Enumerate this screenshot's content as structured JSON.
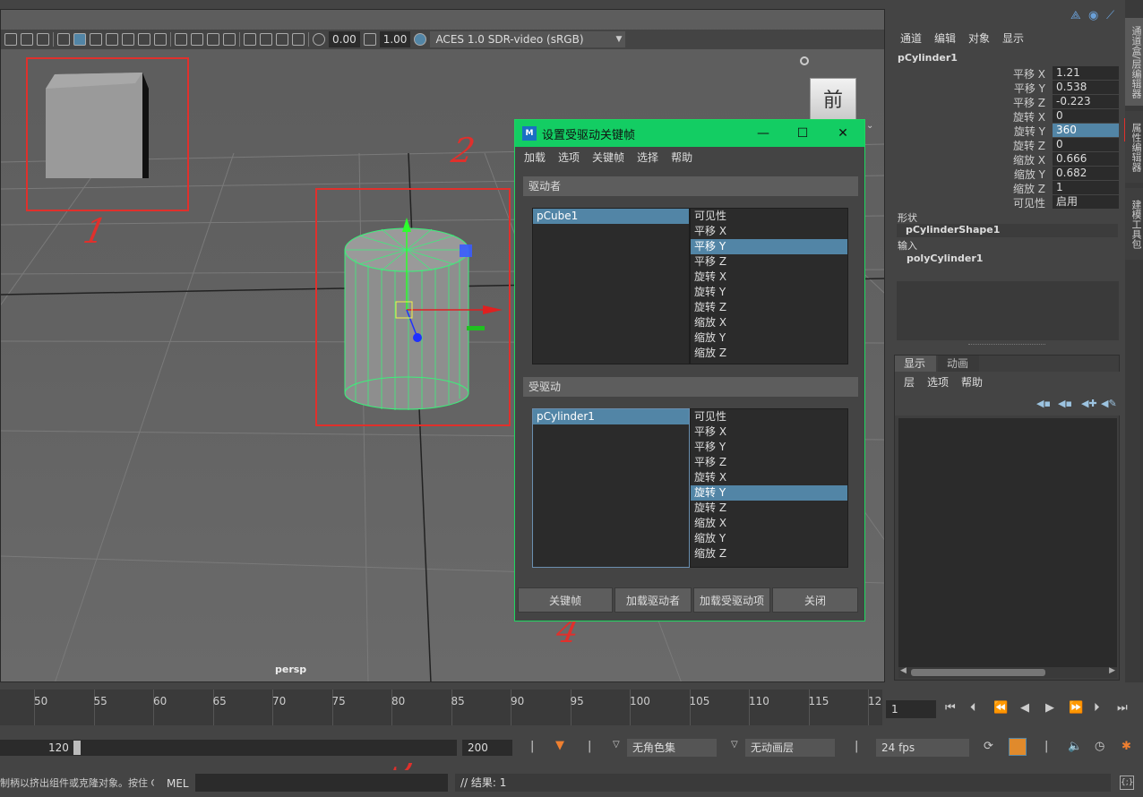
{
  "viewport": {
    "exposure": "0.00",
    "gamma": "1.00",
    "color_space": "ACES 1.0 SDR-video (sRGB)",
    "camera_label": "persp",
    "viewcube_face": "前"
  },
  "annotations": [
    "1",
    "2",
    "3",
    "4",
    "5"
  ],
  "dialog": {
    "title": "设置受驱动关键帧",
    "logo": "M",
    "menu": [
      "加载",
      "选项",
      "关键帧",
      "选择",
      "帮助"
    ],
    "driver_header": "驱动者",
    "driver_object": "pCube1",
    "driver_attrs": [
      "可见性",
      "平移 X",
      "平移 Y",
      "平移 Z",
      "旋转 X",
      "旋转 Y",
      "旋转 Z",
      "缩放 X",
      "缩放 Y",
      "缩放 Z"
    ],
    "driver_selected_attr": "平移 Y",
    "driven_header": "受驱动",
    "driven_object": "pCylinder1",
    "driven_attrs": [
      "可见性",
      "平移 X",
      "平移 Y",
      "平移 Z",
      "旋转 X",
      "旋转 Y",
      "旋转 Z",
      "缩放 X",
      "缩放 Y",
      "缩放 Z"
    ],
    "driven_selected_attr": "旋转 Y",
    "buttons": [
      "关键帧",
      "加载驱动者",
      "加载受驱动项",
      "关闭"
    ]
  },
  "channel_box": {
    "menu": [
      "通道",
      "编辑",
      "对象",
      "显示"
    ],
    "object": "pCylinder1",
    "channels": [
      {
        "label": "平移 X",
        "value": "1.21"
      },
      {
        "label": "平移 Y",
        "value": "0.538"
      },
      {
        "label": "平移 Z",
        "value": "-0.223"
      },
      {
        "label": "旋转 X",
        "value": "0"
      },
      {
        "label": "旋转 Y",
        "value": "360"
      },
      {
        "label": "旋转 Z",
        "value": "0"
      },
      {
        "label": "缩放 X",
        "value": "0.666"
      },
      {
        "label": "缩放 Y",
        "value": "0.682"
      },
      {
        "label": "缩放 Z",
        "value": "1"
      },
      {
        "label": "可见性",
        "value": "启用"
      }
    ],
    "shape_header": "形状",
    "shape_node": "pCylinderShape1",
    "input_header": "输入",
    "input_node": "polyCylinder1"
  },
  "layer_editor": {
    "tabs": [
      "显示",
      "动画"
    ],
    "menu": [
      "层",
      "选项",
      "帮助"
    ]
  },
  "side_tabs": [
    "通道盒/层编辑器",
    "属性编辑器",
    "建模工具包"
  ],
  "timeline": {
    "ticks": [
      "50",
      "55",
      "60",
      "65",
      "70",
      "75",
      "80",
      "85",
      "90",
      "95",
      "100",
      "105",
      "110",
      "115",
      "120"
    ],
    "current_frame": "1"
  },
  "range": {
    "end": "120",
    "max": "200",
    "character_set": "无角色集",
    "anim_layer": "无动画层",
    "fps": "24 fps"
  },
  "command_line": {
    "help_text": "制柄以挤出组件或克隆对象。按住 C",
    "lang": "MEL",
    "result": "// 结果: 1"
  }
}
